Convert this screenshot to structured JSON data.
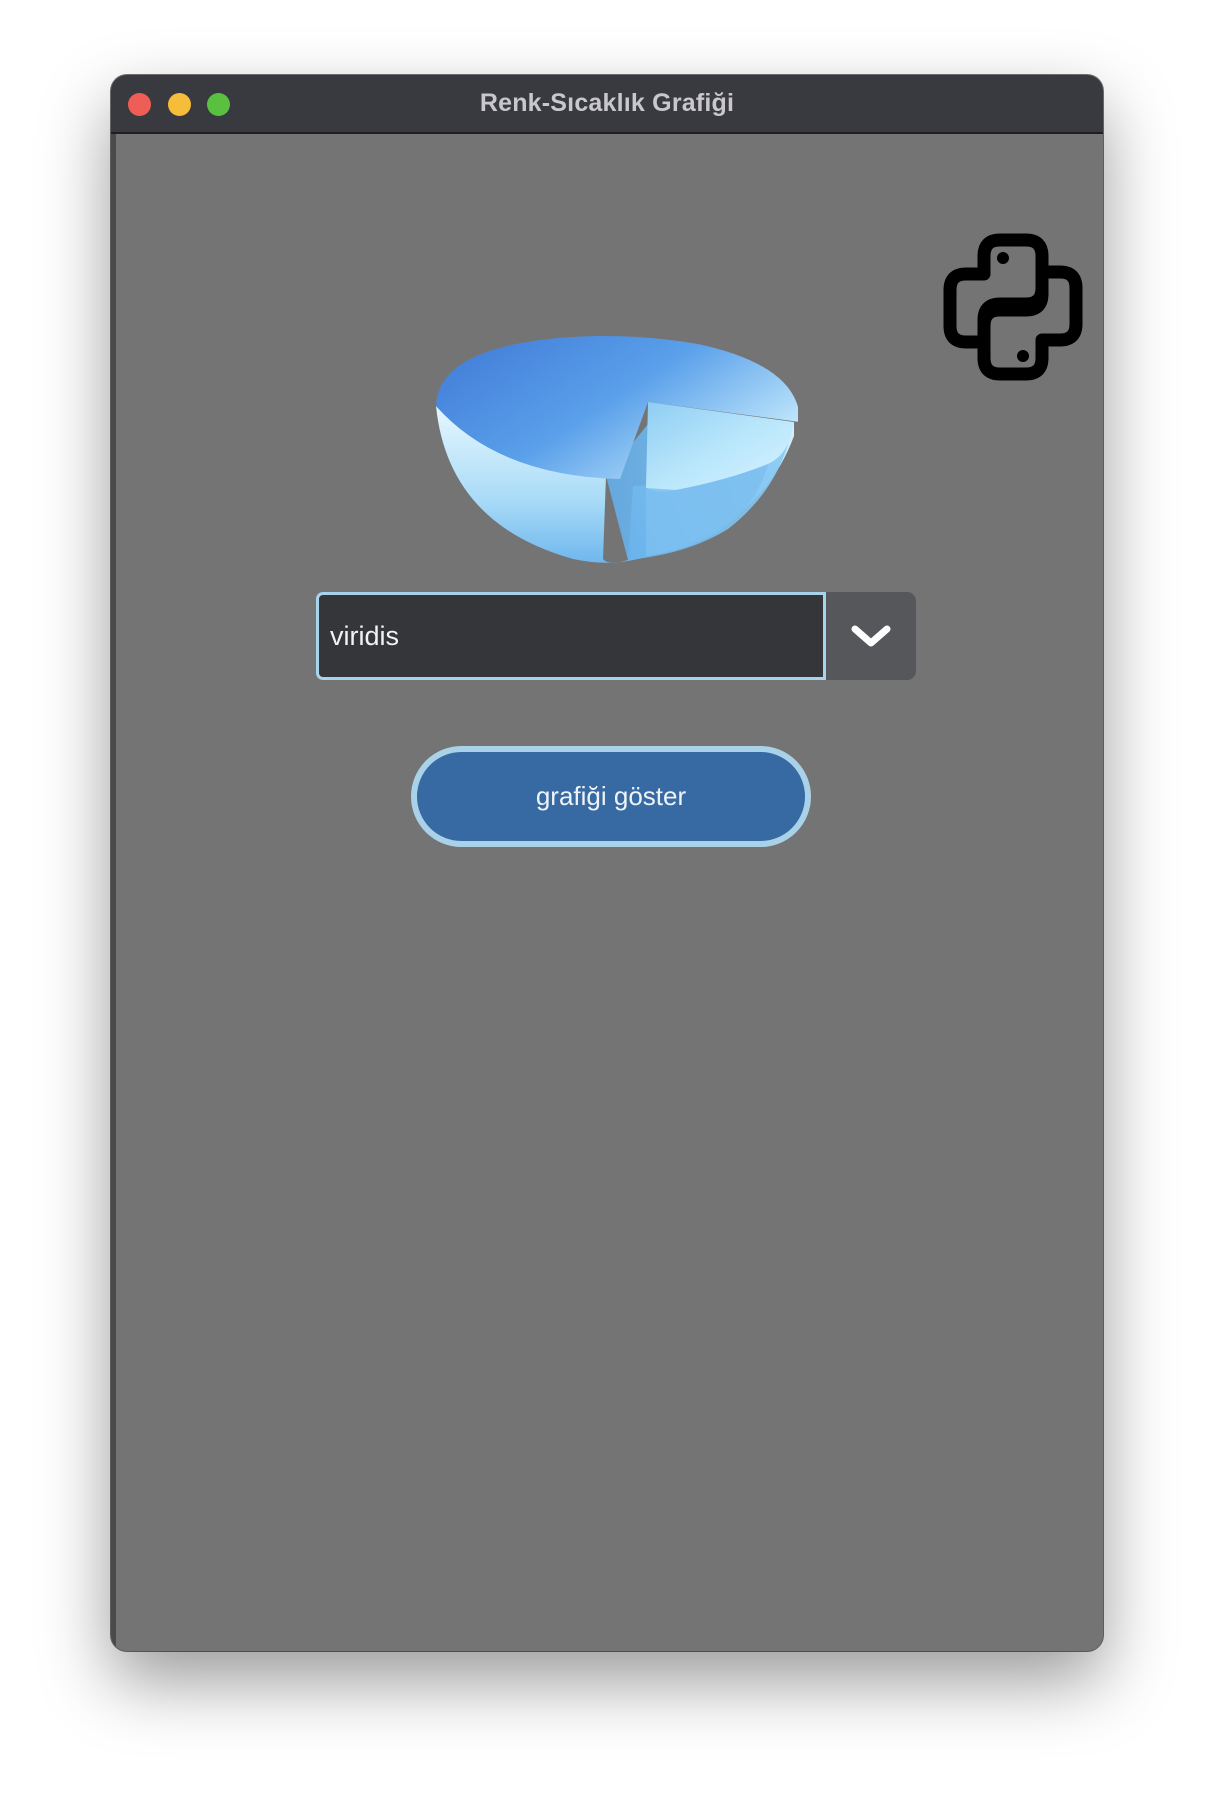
{
  "window": {
    "title": "Renk-Sıcaklık Grafiği",
    "controls": [
      "close-icon",
      "minimize-icon",
      "maximize-icon"
    ]
  },
  "header": {
    "logo_icon": "python-logo-icon",
    "illustration_icon": "pie-chart-icon"
  },
  "colormap_select": {
    "value": "viridis",
    "dropdown_icon": "chevron-down-icon"
  },
  "actions": {
    "show_chart_label": "grafiği göster"
  },
  "colors": {
    "window_bg": "#747474",
    "titlebar_bg": "#393940",
    "accent_button": "#3769a2",
    "focus_border": "#a8d3ec"
  }
}
